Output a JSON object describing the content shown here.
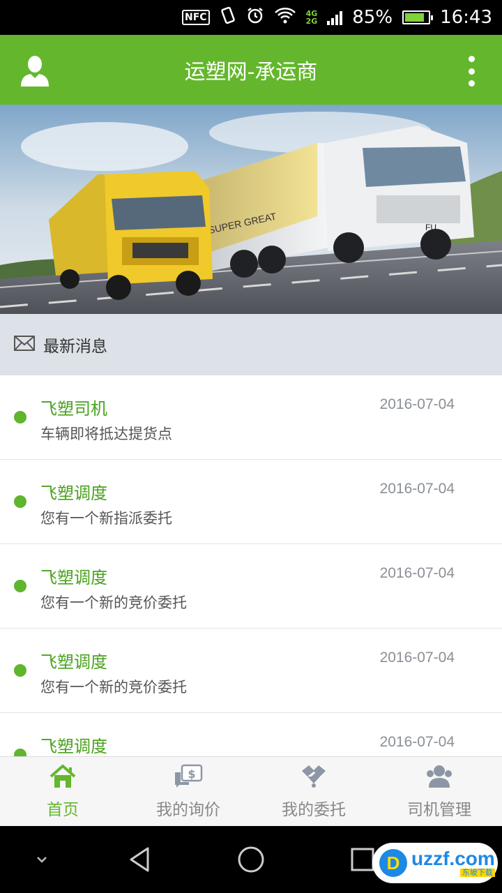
{
  "status_bar": {
    "nfc_label": "NFC",
    "net_top": "4G",
    "net_bottom": "2G",
    "battery": "85%",
    "time": "16:43",
    "icons": [
      "nfc-icon",
      "vibrate-icon",
      "alarm-icon",
      "wifi-icon",
      "signal-icon",
      "battery-icon"
    ]
  },
  "app_bar": {
    "title": "运塑网-承运商",
    "left_icon": "user-icon",
    "right_icon": "more-vert-icon"
  },
  "banner": {
    "image": "trucks-banner",
    "truck_text_1": "SUPER GREAT",
    "truck_text_2": "FU"
  },
  "news": {
    "header_icon": "mail-icon",
    "header_title": "最新消息",
    "items": [
      {
        "sender": "飞塑司机",
        "date": "2016-07-04",
        "content": "车辆即将抵达提货点"
      },
      {
        "sender": "飞塑调度",
        "date": "2016-07-04",
        "content": "您有一个新指派委托"
      },
      {
        "sender": "飞塑调度",
        "date": "2016-07-04",
        "content": "您有一个新的竞价委托"
      },
      {
        "sender": "飞塑调度",
        "date": "2016-07-04",
        "content": "您有一个新的竞价委托"
      },
      {
        "sender": "飞塑调度",
        "date": "2016-07-04",
        "content": ""
      }
    ]
  },
  "tabs": [
    {
      "label": "首页",
      "icon": "home-icon",
      "active": true
    },
    {
      "label": "我的询价",
      "icon": "price-chat-icon",
      "active": false
    },
    {
      "label": "我的委托",
      "icon": "handshake-icon",
      "active": false
    },
    {
      "label": "司机管理",
      "icon": "drivers-icon",
      "active": false
    }
  ],
  "colors": {
    "accent": "#64b72d",
    "accent_text": "#4aa21f",
    "header_bg": "#dde1e8",
    "inactive_tab": "#888888"
  },
  "watermark": {
    "logo": "D",
    "main": "uzzf.com",
    "sub": "东坡下载"
  }
}
